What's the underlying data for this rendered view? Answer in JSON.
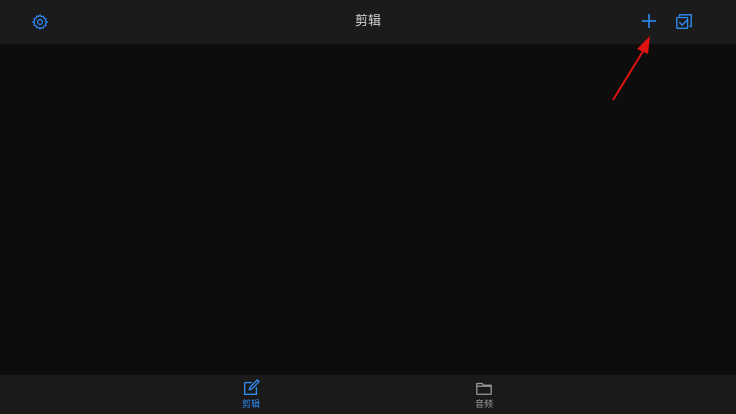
{
  "header": {
    "title": "剪辑",
    "settings_icon": "gear-icon",
    "add_icon": "plus-icon",
    "select_icon": "checkbox-select-icon"
  },
  "tabbar": {
    "tabs": [
      {
        "label": "剪辑",
        "icon": "edit-pencil-icon",
        "active": true
      },
      {
        "label": "音频",
        "icon": "folder-icon",
        "active": false
      }
    ]
  },
  "colors": {
    "accent": "#2f8cf5",
    "inactive": "#9a9a9a",
    "annotation_arrow": "#e01212",
    "background": "#0d0d0d",
    "bar": "#1b1b1b"
  }
}
